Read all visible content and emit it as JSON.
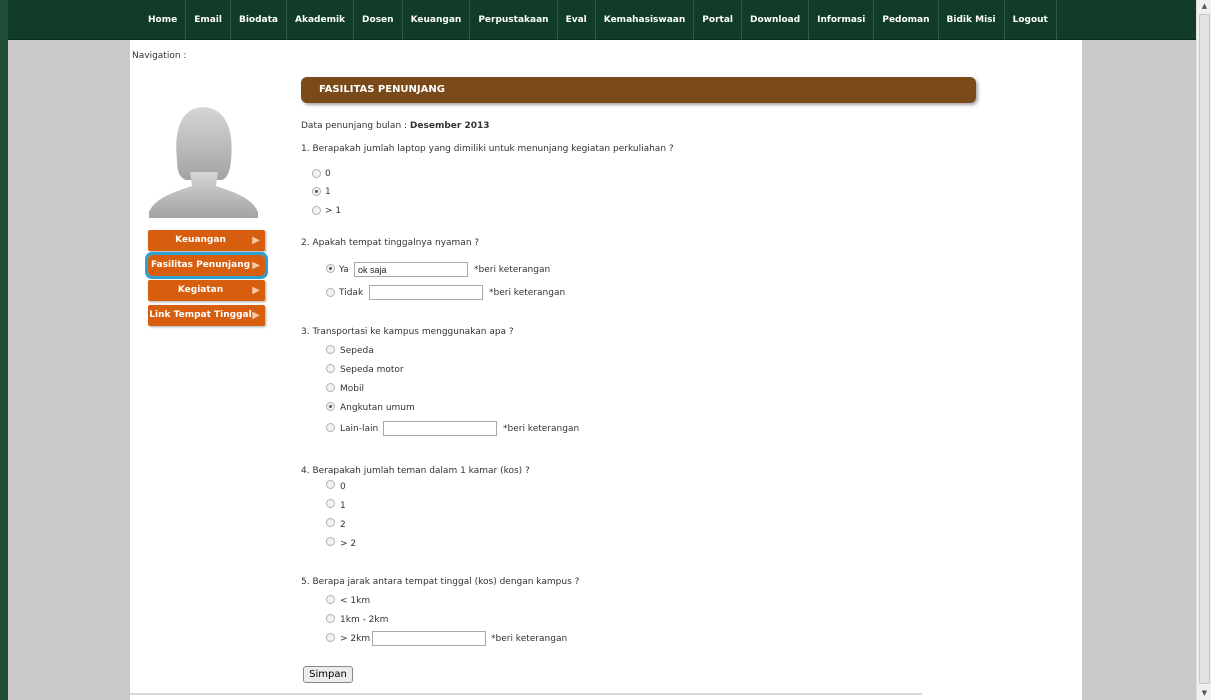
{
  "nav": [
    "Home",
    "Email",
    "Biodata",
    "Akademik",
    "Dosen",
    "Keuangan",
    "Perpustakaan",
    "Eval",
    "Kemahasiswaan",
    "Portal",
    "Download",
    "Informasi",
    "Pedoman",
    "Bidik Misi",
    "Logout"
  ],
  "navigation_label": "Navigation :",
  "sidebar": [
    {
      "label": "Keuangan",
      "active": false
    },
    {
      "label": "Fasilitas Penunjang",
      "active": true
    },
    {
      "label": "Kegiatan",
      "active": false
    },
    {
      "label": "Link Tempat Tinggal",
      "active": false
    }
  ],
  "section_title": "FASILITAS PENUNJANG",
  "period_label": "Data penunjang bulan :",
  "period_value": "Desember 2013",
  "q1": {
    "text": "1. Berapakah jumlah laptop yang dimiliki untuk menunjang kegiatan perkuliahan ?",
    "options": [
      "0",
      "1",
      "> 1"
    ],
    "selected": 1
  },
  "q2": {
    "text": "2. Apakah tempat tinggalnya nyaman ?",
    "options": [
      "Ya",
      "Tidak"
    ],
    "selected": 0,
    "ya_value": "ok saja",
    "tidak_value": "",
    "note": "*beri keterangan"
  },
  "q3": {
    "text": "3. Transportasi ke kampus menggunakan apa ?",
    "options": [
      "Sepeda",
      "Sepeda motor",
      "Mobil",
      "Angkutan umum",
      "Lain-lain"
    ],
    "selected": 3,
    "other_value": "",
    "note": "*beri keterangan"
  },
  "q4": {
    "text": "4. Berapakah jumlah teman dalam 1 kamar (kos) ?",
    "options": [
      "0",
      "1",
      "2",
      "> 2"
    ],
    "selected": -1
  },
  "q5": {
    "text": "5. Berapa jarak antara tempat tinggal (kos) dengan kampus ?",
    "options": [
      "< 1km",
      "1km - 2km",
      "> 2km"
    ],
    "selected": -1,
    "other_value": "",
    "note": "*beri keterangan"
  },
  "submit_label": "Simpan",
  "colors": {
    "topbar": "#103c28",
    "sidebar_button": "#d85e0f",
    "header": "#7a4a1a",
    "active_outline": "#2d9fd3"
  }
}
